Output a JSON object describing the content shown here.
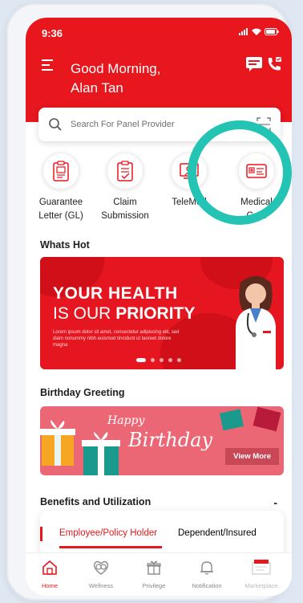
{
  "status_bar": {
    "time": "9:36"
  },
  "header": {
    "greeting_line1": "Good Morning,",
    "greeting_line2": "Alan Tan"
  },
  "search": {
    "placeholder": "Search For Panel Provider"
  },
  "shortcuts": [
    {
      "line1": "Guarantee",
      "line2": "Letter (GL)"
    },
    {
      "line1": "Claim",
      "line2": "Submission"
    },
    {
      "line1": "TeleMed",
      "line2": ""
    },
    {
      "line1": "Medical",
      "line2": "Card"
    }
  ],
  "whats_hot": {
    "title": "Whats Hot",
    "banner": {
      "line1": "YOUR HEALTH",
      "line2_light": "IS OUR ",
      "line2_bold": "PRIORITY",
      "body": "Lorem ipsum dolor sit amet, consectetur adipiscing elit, sed diam nonummy nibh euismod tincidunt ut laoreet dolore magna"
    }
  },
  "birthday": {
    "title": "Birthday Greeting",
    "happy": "Happy",
    "birthday": "Birthday",
    "view_more": "View More"
  },
  "benefits": {
    "title": "Benefits and Utilization",
    "collapse_symbol": "-",
    "tabs": [
      "Employee/Policy Holder",
      "Dependent/Insured"
    ]
  },
  "bottom_nav": [
    {
      "label": "Home",
      "active": true
    },
    {
      "label": "Wellness",
      "active": false
    },
    {
      "label": "Privilege",
      "active": false
    },
    {
      "label": "Notification",
      "active": false
    },
    {
      "label": "Marketplace",
      "active": false
    }
  ],
  "colors": {
    "brand_red": "#e8161d",
    "highlight_teal": "#24c4b5",
    "birthday_pink": "#ec6775"
  }
}
